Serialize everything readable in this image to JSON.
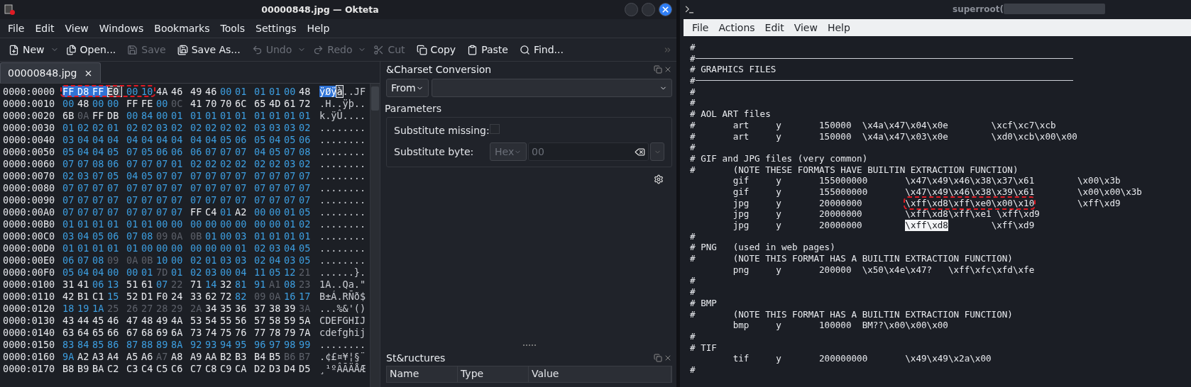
{
  "okteta": {
    "title": "00000848.jpg — Okteta",
    "menu": [
      "File",
      "Edit",
      "View",
      "Windows",
      "Bookmarks",
      "Tools",
      "Settings",
      "Help"
    ],
    "toolbar": [
      {
        "kind": "new",
        "label": "New",
        "disabled": false,
        "dropdown": true
      },
      {
        "kind": "open",
        "label": "Open...",
        "disabled": false,
        "dropdown": false
      },
      {
        "kind": "save",
        "label": "Save",
        "disabled": true,
        "dropdown": false
      },
      {
        "kind": "saveas",
        "label": "Save As...",
        "disabled": false,
        "dropdown": false
      },
      {
        "kind": "undo",
        "label": "Undo",
        "disabled": true,
        "dropdown": true
      },
      {
        "kind": "redo",
        "label": "Redo",
        "disabled": true,
        "dropdown": true
      },
      {
        "kind": "cut",
        "label": "Cut",
        "disabled": true,
        "dropdown": false
      },
      {
        "kind": "copy",
        "label": "Copy",
        "disabled": false,
        "dropdown": false
      },
      {
        "kind": "paste",
        "label": "Paste",
        "disabled": false,
        "dropdown": false
      },
      {
        "kind": "find",
        "label": "Find...",
        "disabled": false,
        "dropdown": false
      }
    ],
    "tabs": [
      {
        "label": "00000848.jpg",
        "selected": true
      }
    ],
    "hex_view": {
      "rows": [
        {
          "offset": "0000:0000",
          "bytes": "FF D8 FF E0 00 10 4A 46 49 46 00 01 01 01 00 48",
          "annotation": {
            "kind": "outline"
          },
          "marks": [
            {
              "selected": true,
              "cursor": false
            },
            {
              "selected": true,
              "cursor": false
            },
            {
              "selected": true,
              "cursor": false
            },
            {
              "selected": false,
              "cursor": true
            },
            {
              "selected": false,
              "cursor": false
            },
            {
              "selected": false,
              "cursor": false
            }
          ],
          "chars": [
            {
              "text": "ÿØÿ",
              "selected": true,
              "cursor": false
            },
            {
              "text": "à",
              "selected": false,
              "cursor": true
            },
            {
              "text": "..JF",
              "selected": false,
              "cursor": false
            }
          ]
        },
        {
          "offset": "0000:0010",
          "bytes": "00 48 00 00 FF FE 00 0C 41 70 70 6C 65 4D 61 72",
          "chars": ".H..ÿþ.."
        },
        {
          "offset": "0000:0020",
          "bytes": "6B 0A FF DB 00 84 00 01 01 01 01 01 01 01 01 01",
          "chars": "k.ÿÛ...."
        },
        {
          "offset": "0000:0030",
          "bytes": "01 02 02 01 02 02 03 02 02 02 02 02 03 03 03 02",
          "chars": "........"
        },
        {
          "offset": "0000:0040",
          "bytes": "03 04 04 04 04 04 04 04 04 04 05 06 05 04 05 06",
          "chars": "........"
        },
        {
          "offset": "0000:0050",
          "bytes": "05 04 04 05 07 05 06 06 06 07 07 07 04 05 07 08",
          "chars": "........"
        },
        {
          "offset": "0000:0060",
          "bytes": "07 07 08 06 07 07 07 01 02 02 02 02 02 02 03 02",
          "chars": "........"
        },
        {
          "offset": "0000:0070",
          "bytes": "02 03 07 05 04 05 07 07 07 07 07 07 07 07 07 07",
          "chars": "........"
        },
        {
          "offset": "0000:0080",
          "bytes": "07 07 07 07 07 07 07 07 07 07 07 07 07 07 07 07",
          "chars": "........"
        },
        {
          "offset": "0000:0090",
          "bytes": "07 07 07 07 07 07 07 07 07 07 07 07 07 07 07 07",
          "chars": "........"
        },
        {
          "offset": "0000:00A0",
          "bytes": "07 07 07 07 07 07 07 07 FF C4 01 A2 00 00 01 05",
          "chars": "........"
        },
        {
          "offset": "0000:00B0",
          "bytes": "01 01 01 01 01 01 00 00 00 00 00 00 00 00 01 02",
          "chars": "........"
        },
        {
          "offset": "0000:00C0",
          "bytes": "03 04 05 06 07 08 09 0A 0B 01 00 03 01 01 01 01",
          "chars": "........"
        },
        {
          "offset": "0000:00D0",
          "bytes": "01 01 01 01 01 00 00 00 00 00 00 01 02 03 04 05",
          "chars": "........"
        },
        {
          "offset": "0000:00E0",
          "bytes": "06 07 08 09 0A 0B 10 00 02 01 03 03 02 04 03 05",
          "chars": "........"
        },
        {
          "offset": "0000:00F0",
          "bytes": "05 04 04 00 00 01 7D 01 02 03 00 04 11 05 12 21",
          "chars": "......}."
        },
        {
          "offset": "0000:0100",
          "bytes": "31 41 06 13 51 61 07 22 71 14 32 81 91 A1 08 23",
          "chars": "1A..Qa.\""
        },
        {
          "offset": "0000:0110",
          "bytes": "42 B1 C1 15 52 D1 F0 24 33 62 72 82 09 0A 16 17",
          "chars": "B±Á.RÑð$"
        },
        {
          "offset": "0000:0120",
          "bytes": "18 19 1A 25 26 27 28 29 2A 34 35 36 37 38 39 3A",
          "chars": "...%&'()"
        },
        {
          "offset": "0000:0130",
          "bytes": "43 44 45 46 47 48 49 4A 53 54 55 56 57 58 59 5A",
          "chars": "CDEFGHIJ"
        },
        {
          "offset": "0000:0140",
          "bytes": "63 64 65 66 67 68 69 6A 73 74 75 76 77 78 79 7A",
          "chars": "cdefghij"
        },
        {
          "offset": "0000:0150",
          "bytes": "83 84 85 86 87 88 89 8A 92 93 94 95 96 97 98 99",
          "chars": "........"
        },
        {
          "offset": "0000:0160",
          "bytes": "9A A2 A3 A4 A5 A6 A7 A8 A9 AA B2 B3 B4 B5 B6 B7",
          "chars": ".¢£¤¥¦§¨"
        },
        {
          "offset": "0000:0170",
          "bytes": "B8 B9 BA C2 C3 C4 C5 C6 C7 C8 C9 CA D2 D3 D4 D5",
          "chars": "¸¹ºÂÃÄÅÆ"
        }
      ]
    },
    "charset_panel": {
      "title": "&Charset Conversion",
      "direction": "From",
      "parameters_title": "Parameters",
      "substitute_missing": {
        "label": "Substitute missing:",
        "checked": false
      },
      "substitute_byte": {
        "label": "Substitute byte:",
        "format": "Hex",
        "value": "00",
        "disabled": true
      }
    },
    "structures_panel": {
      "title": "St&ructures",
      "columns": [
        "Name",
        "Type",
        "Value"
      ]
    }
  },
  "terminal": {
    "title": "superroot(",
    "menu": [
      "File",
      "Actions",
      "Edit",
      "View",
      "Help"
    ],
    "lines": [
      {
        "kind": "text",
        "text": "#"
      },
      {
        "kind": "rule",
        "text": "#"
      },
      {
        "kind": "text",
        "text": "# GRAPHICS FILES"
      },
      {
        "kind": "rule",
        "text": "#"
      },
      {
        "kind": "text",
        "text": "#"
      },
      {
        "kind": "text",
        "text": "#"
      },
      {
        "kind": "text",
        "text": "# AOL ART files"
      },
      {
        "kind": "text",
        "text": "#       art     y       150000  \\x4a\\x47\\x04\\x0e        \\xcf\\xc7\\xcb"
      },
      {
        "kind": "text",
        "text": "#       art     y       150000  \\x4a\\x47\\x03\\x0e        \\xd0\\xcb\\x00\\x00"
      },
      {
        "kind": "text",
        "text": "#"
      },
      {
        "kind": "text",
        "text": "# GIF and JPG files (very common)"
      },
      {
        "kind": "text",
        "text": "#       (NOTE THESE FORMATS HAVE BUILTIN EXTRACTION FUNCTION)"
      },
      {
        "kind": "text",
        "text": "        gif     y       155000000       \\x47\\x49\\x46\\x38\\x37\\x61        \\x00\\x3b"
      },
      {
        "kind": "text",
        "text": "        gif     y       155000000       \\x47\\x49\\x46\\x38\\x39\\x61        \\x00\\x00\\x3b"
      },
      {
        "kind": "marked",
        "parts": [
          {
            "text": "        jpg     y       20000000        ",
            "outlined": false,
            "highlighted": false
          },
          {
            "text": "\\xff\\xd8\\xff\\xe0\\x00\\x10",
            "outlined": true,
            "highlighted": false
          },
          {
            "text": "        \\xff\\xd9",
            "outlined": false,
            "highlighted": false
          }
        ]
      },
      {
        "kind": "text",
        "text": "        jpg     y       20000000        \\xff\\xd8\\xff\\xe1 \\xff\\xd9"
      },
      {
        "kind": "marked",
        "parts": [
          {
            "text": "        jpg     y       20000000        ",
            "outlined": false,
            "highlighted": false
          },
          {
            "text": "\\xff\\xd8",
            "outlined": false,
            "highlighted": true
          },
          {
            "text": "        \\xff\\xd9",
            "outlined": false,
            "highlighted": false
          }
        ]
      },
      {
        "kind": "text",
        "text": "#"
      },
      {
        "kind": "text",
        "text": "# PNG   (used in web pages)"
      },
      {
        "kind": "text",
        "text": "#       (NOTE THIS FORMAT HAS A BUILTIN EXTRACTION FUNCTION)"
      },
      {
        "kind": "text",
        "text": "        png     y       200000  \\x50\\x4e\\x47?   \\xff\\xfc\\xfd\\xfe"
      },
      {
        "kind": "text",
        "text": "#"
      },
      {
        "kind": "text",
        "text": "#"
      },
      {
        "kind": "text",
        "text": "# BMP"
      },
      {
        "kind": "text",
        "text": "#       (NOTE THIS FORMAT HAS A BUILTIN EXTRACTION FUNCTION)"
      },
      {
        "kind": "text",
        "text": "        bmp     y       100000  BM??\\x00\\x00\\x00"
      },
      {
        "kind": "text",
        "text": "#"
      },
      {
        "kind": "text",
        "text": "# TIF"
      },
      {
        "kind": "text",
        "text": "        tif     y       200000000       \\x49\\x49\\x2a\\x00"
      },
      {
        "kind": "text",
        "text": "#"
      }
    ]
  }
}
